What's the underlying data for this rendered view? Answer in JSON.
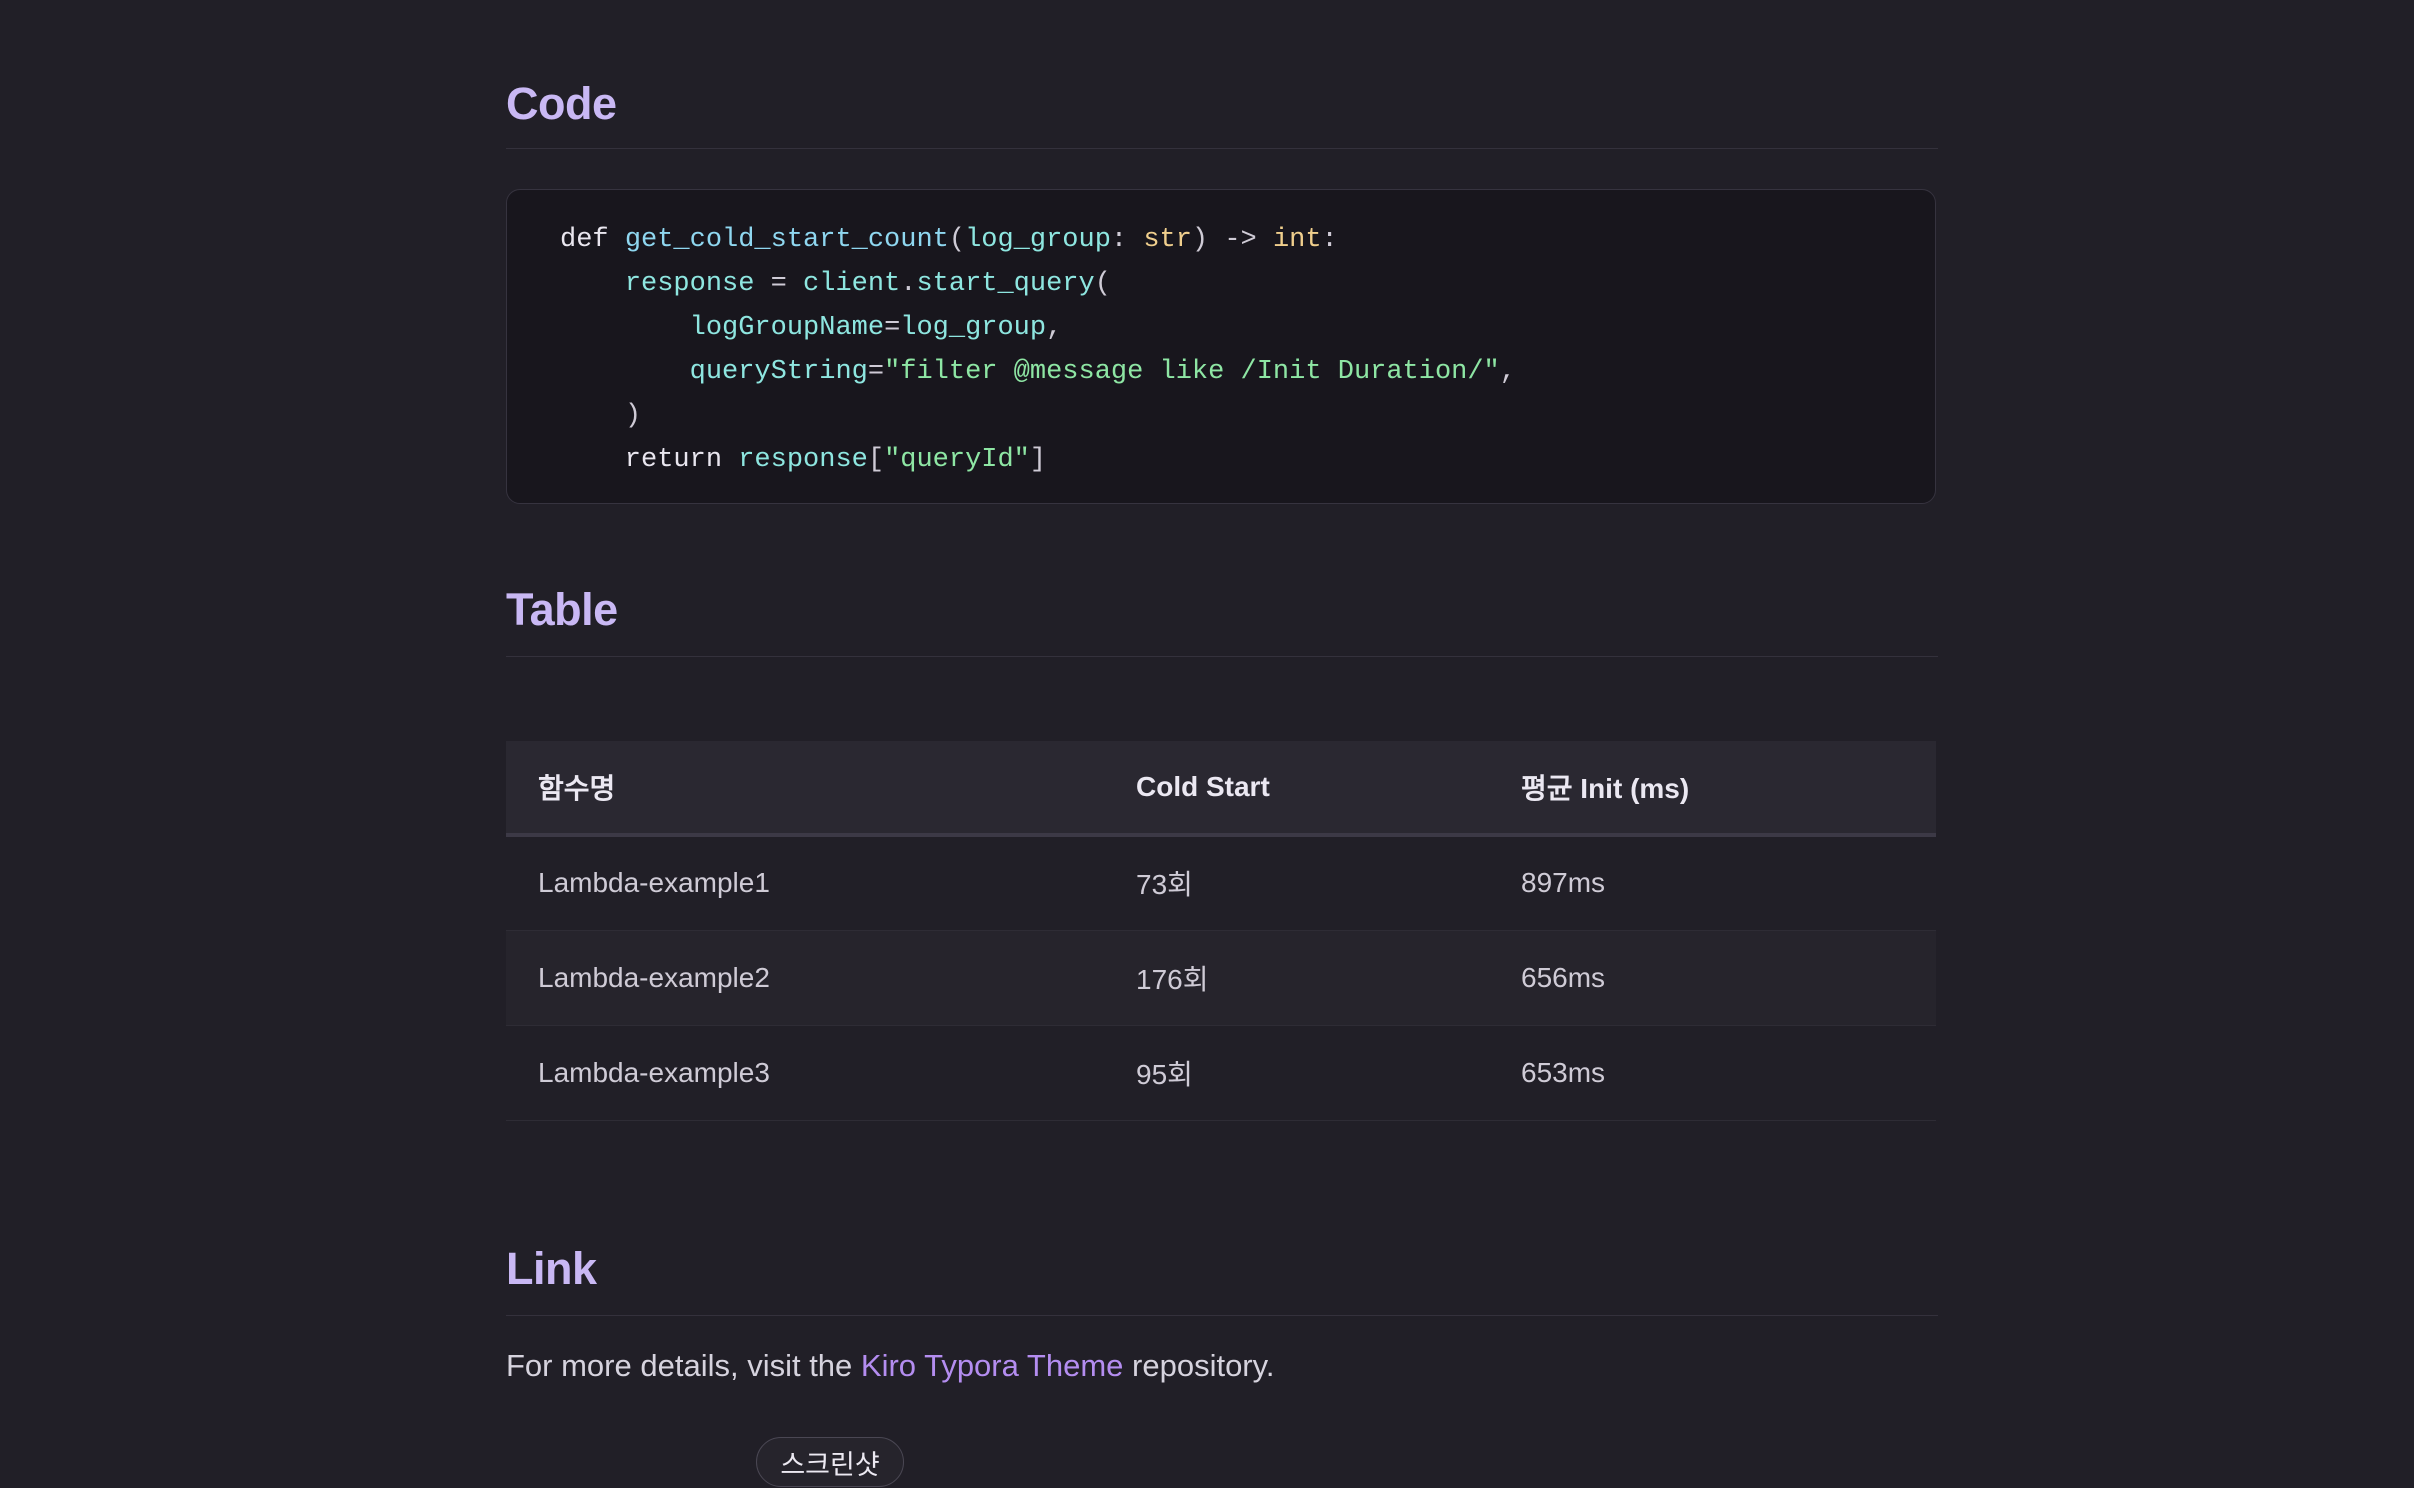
{
  "sections": {
    "code_heading": "Code",
    "table_heading": "Table",
    "link_heading": "Link"
  },
  "code": {
    "language": "python",
    "lines": [
      [
        [
          "kw",
          "def "
        ],
        [
          "fn",
          "get_cold_start_count"
        ],
        [
          "punc",
          "("
        ],
        [
          "id",
          "log_group"
        ],
        [
          "punc",
          ": "
        ],
        [
          "type",
          "str"
        ],
        [
          "punc",
          ") -> "
        ],
        [
          "type",
          "int"
        ],
        [
          "punc",
          ":"
        ]
      ],
      [
        [
          "kw",
          "    "
        ],
        [
          "id",
          "response"
        ],
        [
          "punc",
          " = "
        ],
        [
          "id",
          "client"
        ],
        [
          "punc",
          "."
        ],
        [
          "id",
          "start_query"
        ],
        [
          "punc",
          "("
        ]
      ],
      [
        [
          "kw",
          "        "
        ],
        [
          "id",
          "logGroupName"
        ],
        [
          "punc",
          "="
        ],
        [
          "id",
          "log_group"
        ],
        [
          "punc",
          ","
        ]
      ],
      [
        [
          "kw",
          "        "
        ],
        [
          "id",
          "queryString"
        ],
        [
          "punc",
          "="
        ],
        [
          "str",
          "\"filter @message like /Init Duration/\""
        ],
        [
          "punc",
          ","
        ]
      ],
      [
        [
          "kw",
          "    "
        ],
        [
          "punc",
          ")"
        ]
      ],
      [
        [
          "kw",
          "    return "
        ],
        [
          "id",
          "response"
        ],
        [
          "punc",
          "["
        ],
        [
          "str",
          "\"queryId\""
        ],
        [
          "punc",
          "]"
        ]
      ]
    ]
  },
  "table": {
    "headers": [
      "함수명",
      "Cold Start",
      "평균 Init (ms)"
    ],
    "rows": [
      [
        "Lambda-example1",
        "73회",
        "897ms"
      ],
      [
        "Lambda-example2",
        "176회",
        "656ms"
      ],
      [
        "Lambda-example3",
        "95회",
        "653ms"
      ]
    ]
  },
  "link_paragraph": {
    "before": "For more details, visit the ",
    "link_text": "Kiro Typora Theme",
    "after": " repository."
  },
  "screenshot_button": {
    "label": "스크린샷"
  },
  "colors": {
    "background": "#211f27",
    "heading": "#c9b8f4",
    "link": "#b48df0",
    "code_background": "#18161d"
  }
}
